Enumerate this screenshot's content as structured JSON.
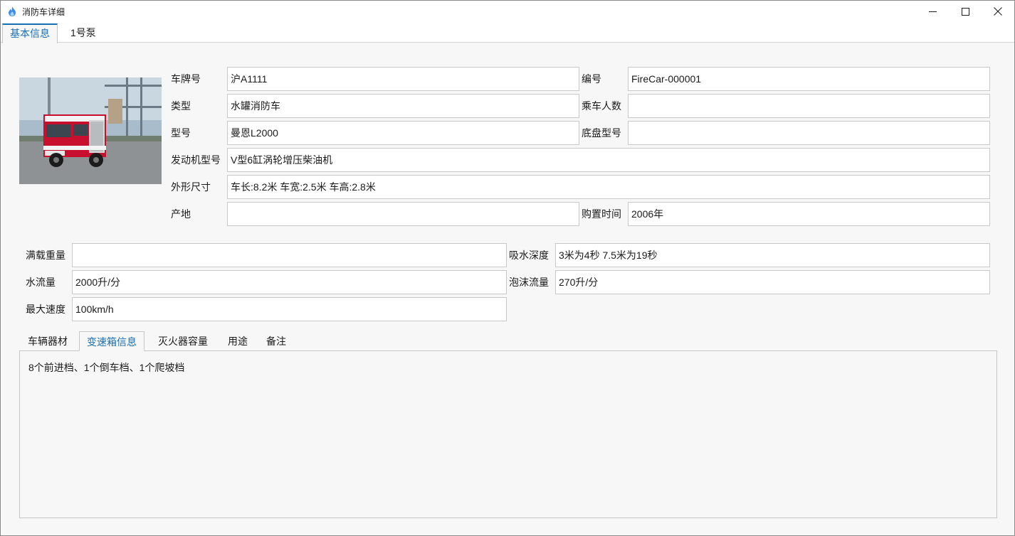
{
  "window": {
    "title": "消防车详细",
    "icon": "flame-icon"
  },
  "top_tabs": [
    {
      "label": "基本信息",
      "active": true
    },
    {
      "label": "1号泵",
      "active": false
    }
  ],
  "vehicle": {
    "plate_label": "车牌号",
    "plate_value": "沪A1111",
    "code_label": "编号",
    "code_value": "FireCar-000001",
    "type_label": "类型",
    "type_value": "水罐消防车",
    "crew_label": "乘车人数",
    "crew_value": "",
    "model_label": "型号",
    "model_value": "曼恩L2000",
    "chassis_label": "底盘型号",
    "chassis_value": "",
    "engine_label": "发动机型号",
    "engine_value": "V型6缸涡轮增压柴油机",
    "size_label": "外形尺寸",
    "size_value": "车长:8.2米 车宽:2.5米 车高:2.8米",
    "origin_label": "产地",
    "origin_value": "",
    "purchase_label": "购置时间",
    "purchase_value": "2006年",
    "load_label": "满载重量",
    "load_value": "",
    "suction_label": "吸水深度",
    "suction_value": "3米为4秒 7.5米为19秒",
    "water_label": "水流量",
    "water_value": "2000升/分",
    "foam_label": "泡沫流量",
    "foam_value": "270升/分",
    "speed_label": "最大速度",
    "speed_value": "100km/h"
  },
  "sub_tabs": [
    {
      "label": "车辆器材",
      "active": false
    },
    {
      "label": "变速箱信息",
      "active": true
    },
    {
      "label": "灭火器容量",
      "active": false
    },
    {
      "label": "用途",
      "active": false
    },
    {
      "label": "备注",
      "active": false
    }
  ],
  "sub_panel": {
    "text": "8个前进档、1个倒车档、1个爬坡档"
  },
  "colors": {
    "accent": "#1a6fb3",
    "truck_red": "#c8102e"
  }
}
